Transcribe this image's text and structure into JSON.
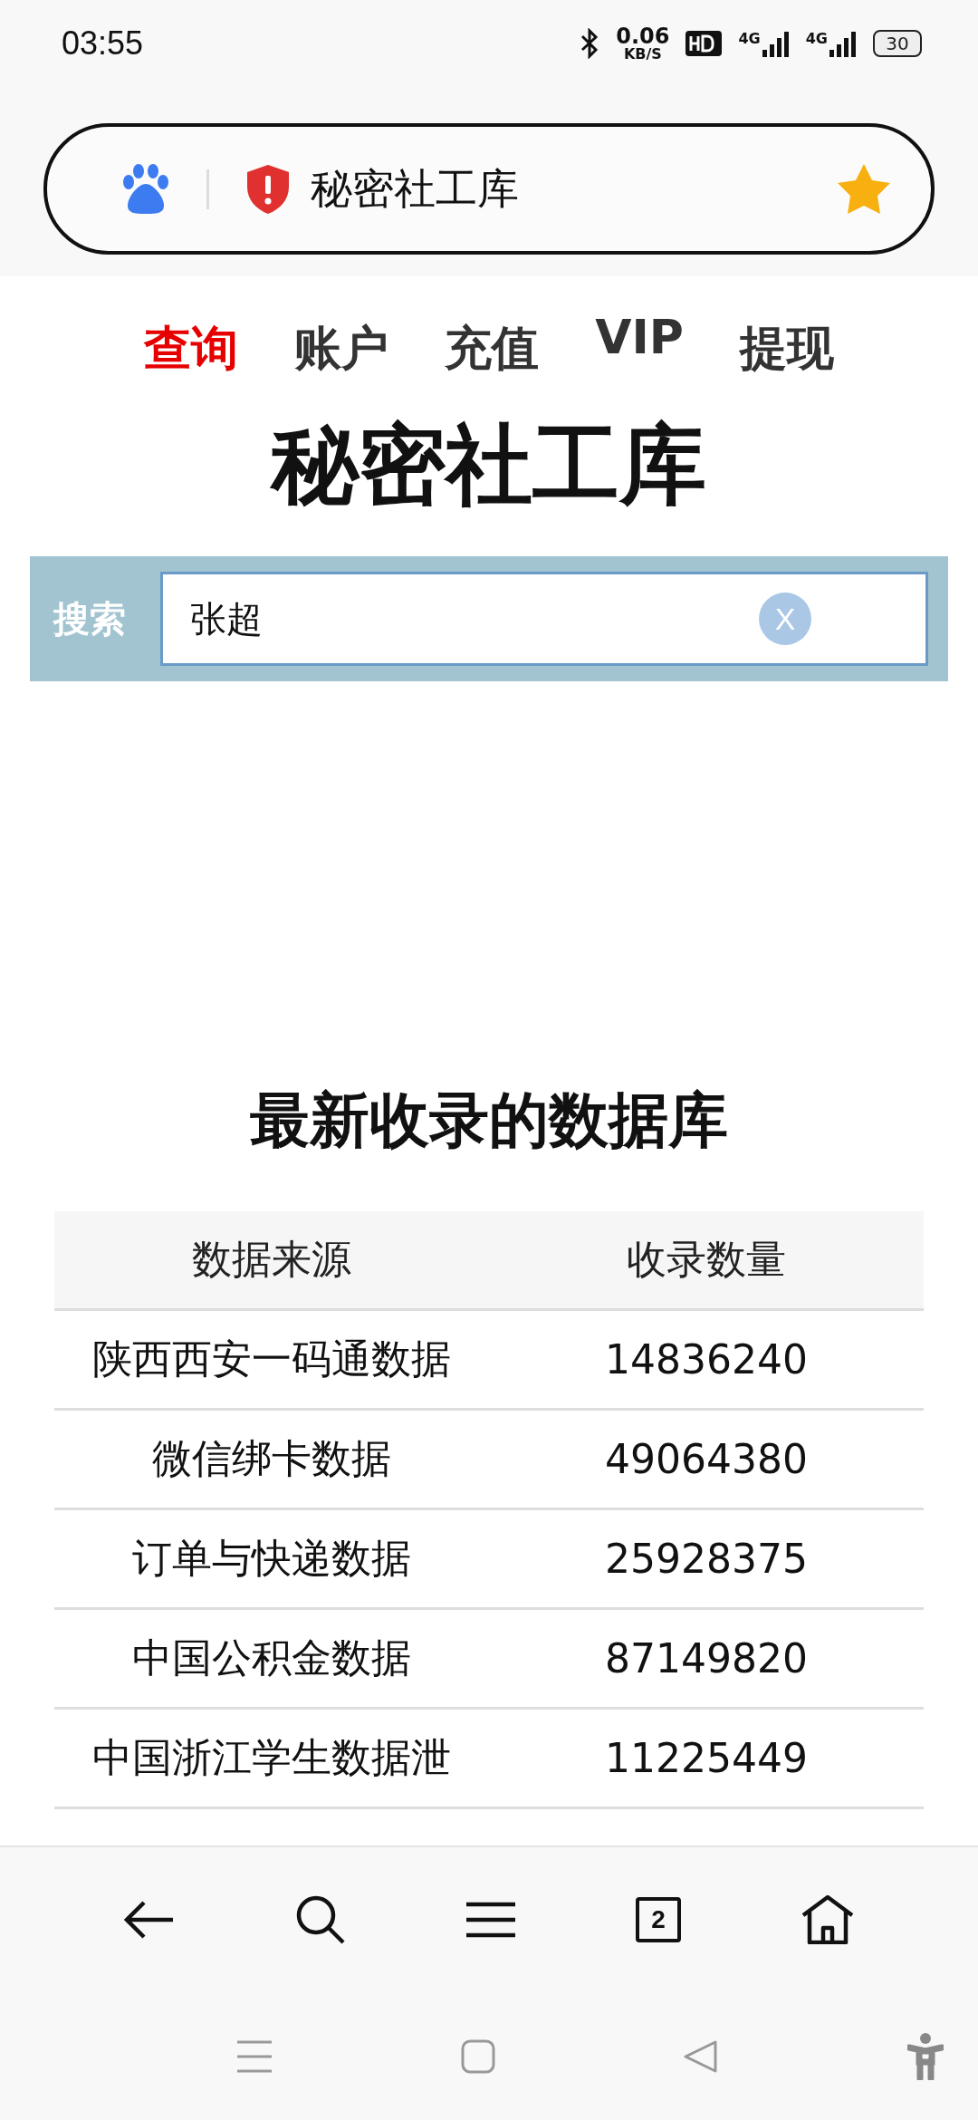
{
  "status_bar": {
    "time": "03:55",
    "speed_value": "0.06",
    "speed_unit": "KB/S",
    "sims": [
      {
        "network": "4G"
      },
      {
        "network": "4G"
      }
    ],
    "battery": "30"
  },
  "address_bar": {
    "title": "秘密社工库",
    "bookmarked": true
  },
  "nav": [
    {
      "label": "查询",
      "selected": true
    },
    {
      "label": "账户",
      "selected": false
    },
    {
      "label": "充值",
      "selected": false
    },
    {
      "label": "VIP",
      "selected": false
    },
    {
      "label": "提现",
      "selected": false
    }
  ],
  "page_title": "秘密社工库",
  "search": {
    "label": "搜索",
    "value": "张超",
    "clear": "X"
  },
  "table": {
    "title": "最新收录的数据库",
    "columns": [
      "数据来源",
      "收录数量"
    ],
    "rows": [
      [
        "陕西西安一码通数据",
        "14836240"
      ],
      [
        "微信绑卡数据",
        "49064380"
      ],
      [
        "订单与快递数据",
        "25928375"
      ],
      [
        "中国公积金数据",
        "87149820"
      ],
      [
        "中国浙江学生数据泄",
        "11225449"
      ]
    ]
  },
  "toolbar": {
    "tab_count": "2"
  }
}
